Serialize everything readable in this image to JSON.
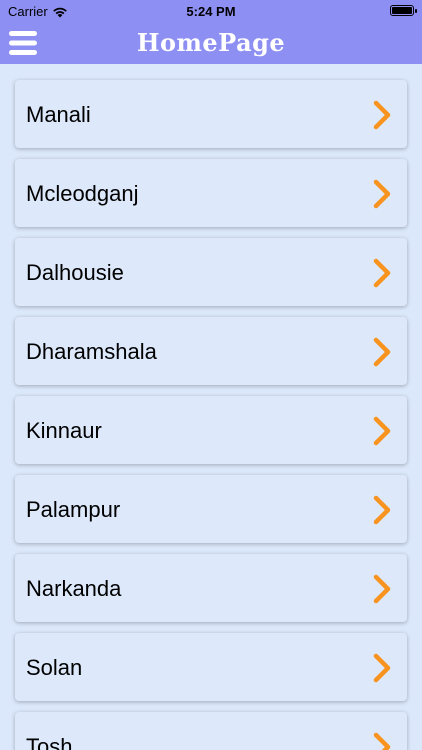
{
  "statusbar": {
    "carrier": "Carrier",
    "time": "5:24 PM",
    "wifi_icon": "wifi-icon",
    "battery_icon": "battery-icon"
  },
  "navbar": {
    "title": "HomePage",
    "menu_icon": "hamburger-icon",
    "background": "#8d8ff3"
  },
  "list": {
    "chevron_color": "#f7931e",
    "items": [
      {
        "label": "Manali"
      },
      {
        "label": "Mcleodganj"
      },
      {
        "label": "Dalhousie"
      },
      {
        "label": "Dharamshala"
      },
      {
        "label": "Kinnaur"
      },
      {
        "label": "Palampur"
      },
      {
        "label": "Narkanda"
      },
      {
        "label": "Solan"
      },
      {
        "label": "Tosh"
      }
    ]
  }
}
